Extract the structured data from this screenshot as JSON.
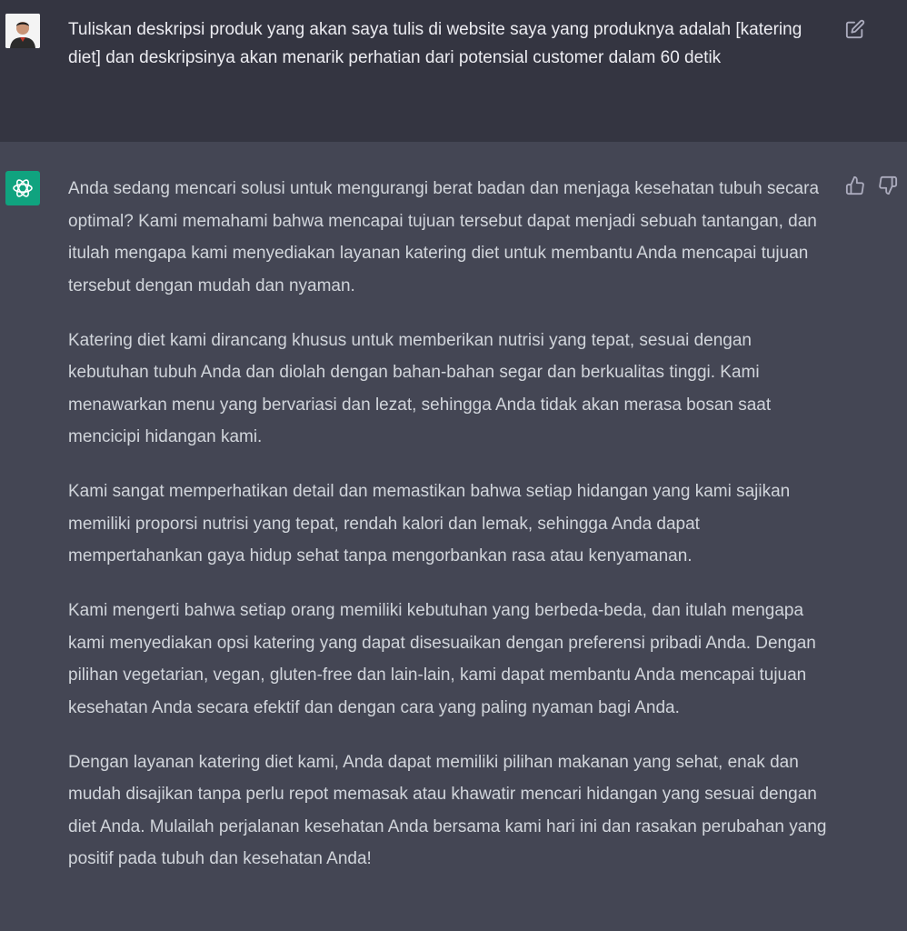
{
  "user_message": {
    "text": "Tuliskan deskripsi produk yang akan saya tulis di website saya yang produknya adalah [katering diet] dan deskripsinya akan menarik perhatian dari potensial customer dalam 60 detik",
    "avatar_icon": "user-photo-avatar",
    "edit_icon": "edit-icon"
  },
  "assistant_message": {
    "avatar_icon": "chatgpt-logo-icon",
    "feedback_icons": [
      "thumbs-up-icon",
      "thumbs-down-icon"
    ],
    "paragraphs": [
      "Anda sedang mencari solusi untuk mengurangi berat badan dan menjaga kesehatan tubuh secara optimal? Kami memahami bahwa mencapai tujuan tersebut dapat menjadi sebuah tantangan, dan itulah mengapa kami menyediakan layanan katering diet untuk membantu Anda mencapai tujuan tersebut dengan mudah dan nyaman.",
      "Katering diet kami dirancang khusus untuk memberikan nutrisi yang tepat, sesuai dengan kebutuhan tubuh Anda dan diolah dengan bahan-bahan segar dan berkualitas tinggi. Kami menawarkan menu yang bervariasi dan lezat, sehingga Anda tidak akan merasa bosan saat mencicipi hidangan kami.",
      "Kami sangat memperhatikan detail dan memastikan bahwa setiap hidangan yang kami sajikan memiliki proporsi nutrisi yang tepat, rendah kalori dan lemak, sehingga Anda dapat mempertahankan gaya hidup sehat tanpa mengorbankan rasa atau kenyamanan.",
      "Kami mengerti bahwa setiap orang memiliki kebutuhan yang berbeda-beda, dan itulah mengapa kami menyediakan opsi katering yang dapat disesuaikan dengan preferensi pribadi Anda. Dengan pilihan vegetarian, vegan, gluten-free dan lain-lain, kami dapat membantu Anda mencapai tujuan kesehatan Anda secara efektif dan dengan cara yang paling nyaman bagi Anda.",
      "Dengan layanan katering diet kami, Anda dapat memiliki pilihan makanan yang sehat, enak dan mudah disajikan tanpa perlu repot memasak atau khawatir mencari hidangan yang sesuai dengan diet Anda. Mulailah perjalanan kesehatan Anda bersama kami hari ini dan rasakan perubahan yang positif pada tubuh dan kesehatan Anda!"
    ]
  },
  "colors": {
    "user_row_bg": "#343541",
    "assistant_row_bg": "#444654",
    "brand_green": "#10a37f",
    "text": "#d1d5db"
  }
}
